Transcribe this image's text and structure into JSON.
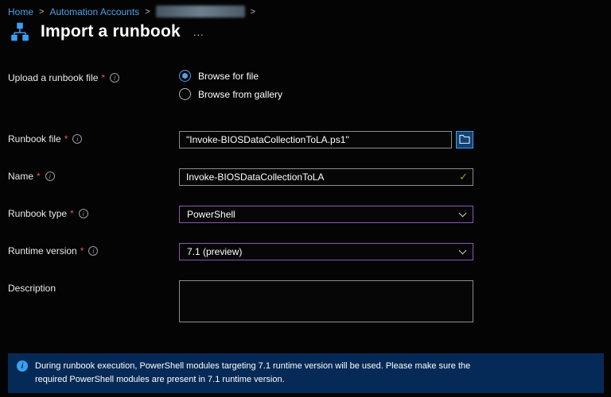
{
  "breadcrumb": {
    "separator": ">",
    "items": [
      {
        "label": "Home"
      },
      {
        "label": "Automation Accounts"
      },
      {
        "label": "",
        "redacted": true
      }
    ]
  },
  "header": {
    "title": "Import a runbook",
    "more_label": "..."
  },
  "ui": {
    "required_marker": "*",
    "info_glyph": "i",
    "check_glyph": "✓"
  },
  "form": {
    "upload_file": {
      "label": "Upload a runbook file",
      "options": [
        {
          "label": "Browse for file",
          "selected": true
        },
        {
          "label": "Browse from gallery",
          "selected": false
        }
      ]
    },
    "runbook_file": {
      "label": "Runbook file",
      "value": "\"Invoke-BIOSDataCollectionToLA.ps1\""
    },
    "name": {
      "label": "Name",
      "value": "Invoke-BIOSDataCollectionToLA"
    },
    "runbook_type": {
      "label": "Runbook type",
      "value": "PowerShell"
    },
    "runtime_version": {
      "label": "Runtime version",
      "value": "7.1 (preview)"
    },
    "description": {
      "label": "Description",
      "value": ""
    }
  },
  "banner": {
    "text": "During runbook execution, PowerShell modules targeting 7.1 runtime version will be used. Please make sure the required PowerShell modules are present in 7.1 runtime version."
  },
  "colors": {
    "accent_blue": "#3aa0f3",
    "breadcrumb_link": "#4ba0e8",
    "focus_purple": "#8a57b5",
    "valid_green": "#73b028",
    "required_red": "#e8564f",
    "banner_bg": "#052a57"
  }
}
